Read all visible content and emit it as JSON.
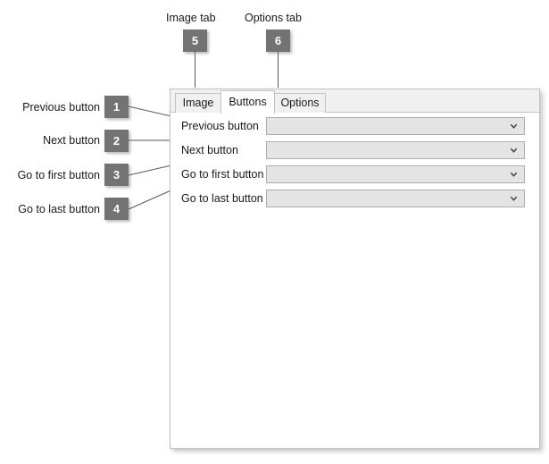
{
  "annotations": {
    "callouts": [
      {
        "id": "1",
        "label": "Previous button",
        "badge": "1"
      },
      {
        "id": "2",
        "label": "Next button",
        "badge": "2"
      },
      {
        "id": "3",
        "label": "Go to first button",
        "badge": "3"
      },
      {
        "id": "4",
        "label": "Go to last button",
        "badge": "4"
      },
      {
        "id": "5",
        "label": "Image tab",
        "badge": "5"
      },
      {
        "id": "6",
        "label": "Options tab",
        "badge": "6"
      }
    ],
    "badge_color": "#737373",
    "badge_text_color": "#ffffff",
    "leader_color": "#5a5a5a"
  },
  "dialog": {
    "tabs": [
      {
        "label": "Image",
        "active": false
      },
      {
        "label": "Buttons",
        "active": true
      },
      {
        "label": "Options",
        "active": false
      }
    ],
    "rows": [
      {
        "label": "Previous button",
        "value": "",
        "placeholder": ""
      },
      {
        "label": "Next button",
        "value": "",
        "placeholder": ""
      },
      {
        "label": "Go to first button",
        "value": "",
        "placeholder": ""
      },
      {
        "label": "Go to last button",
        "value": "",
        "placeholder": ""
      }
    ],
    "combo_icon": "chevron-down-icon",
    "panel_background": "#ffffff",
    "tabstrip_background": "#f0f0f0",
    "combo_background": "#e4e4e4",
    "border_color": "#c2c2c2"
  }
}
